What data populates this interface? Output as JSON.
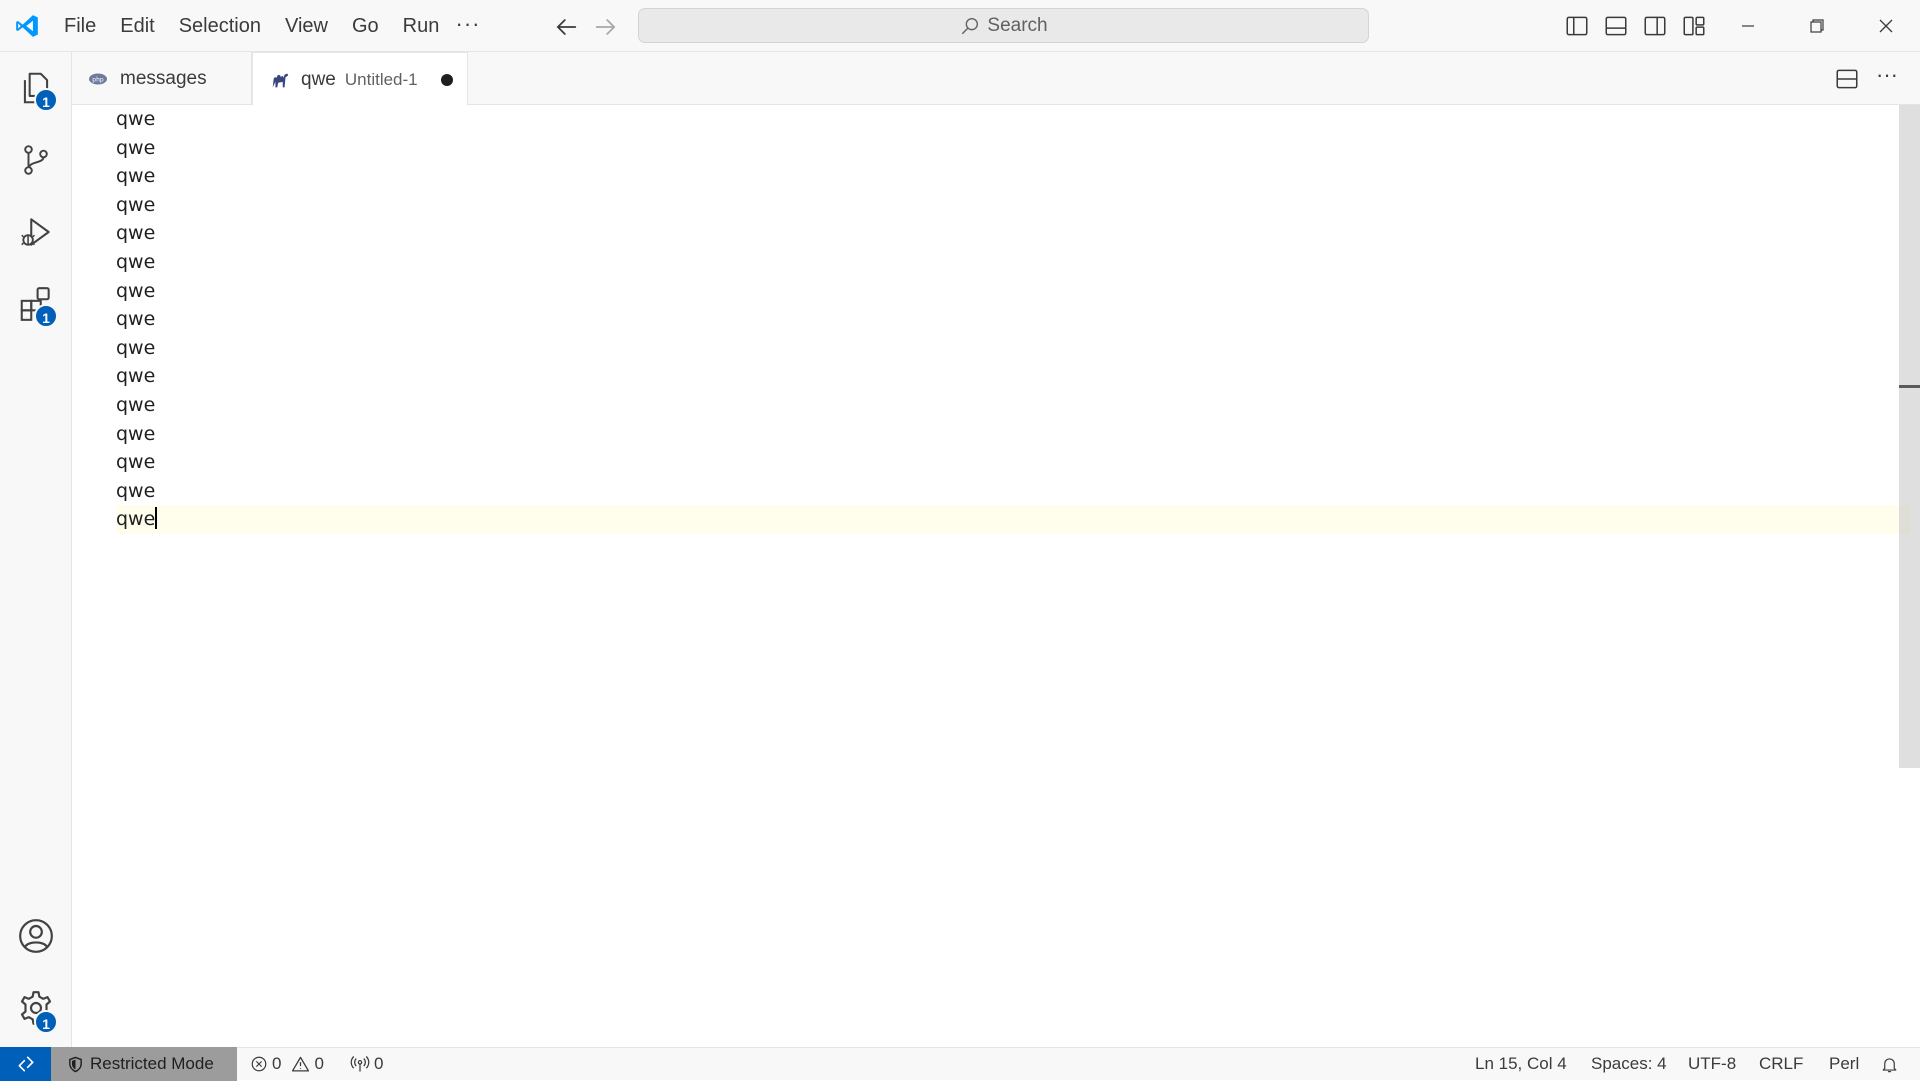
{
  "menu": {
    "file": "File",
    "edit": "Edit",
    "selection": "Selection",
    "view": "View",
    "go": "Go",
    "run": "Run",
    "more": "···"
  },
  "command_center": {
    "label": "Search"
  },
  "activity_bar": {
    "explorer_badge": "1",
    "extensions_badge": "1",
    "settings_badge": "1"
  },
  "tabs": [
    {
      "label": "messages"
    },
    {
      "label": "qwe",
      "description": "Untitled-1"
    }
  ],
  "editor": {
    "lines": [
      "qwe",
      "qwe",
      "qwe",
      "qwe",
      "qwe",
      "qwe",
      "qwe",
      "qwe",
      "qwe",
      "qwe",
      "qwe",
      "qwe",
      "qwe",
      "qwe",
      "qwe"
    ]
  },
  "editor_more": "···",
  "status": {
    "restricted_mode": "Restricted Mode",
    "errors": "0",
    "warnings": "0",
    "ports": "0",
    "cursor_position": "Ln 15, Col 4",
    "indentation": "Spaces: 4",
    "encoding": "UTF-8",
    "eol": "CRLF",
    "language": "Perl"
  },
  "colors": {
    "accent": "#005fb8",
    "logo": "#0098ff",
    "restricted_bg": "#9c9c9c",
    "current_line": "#fffdeb"
  }
}
